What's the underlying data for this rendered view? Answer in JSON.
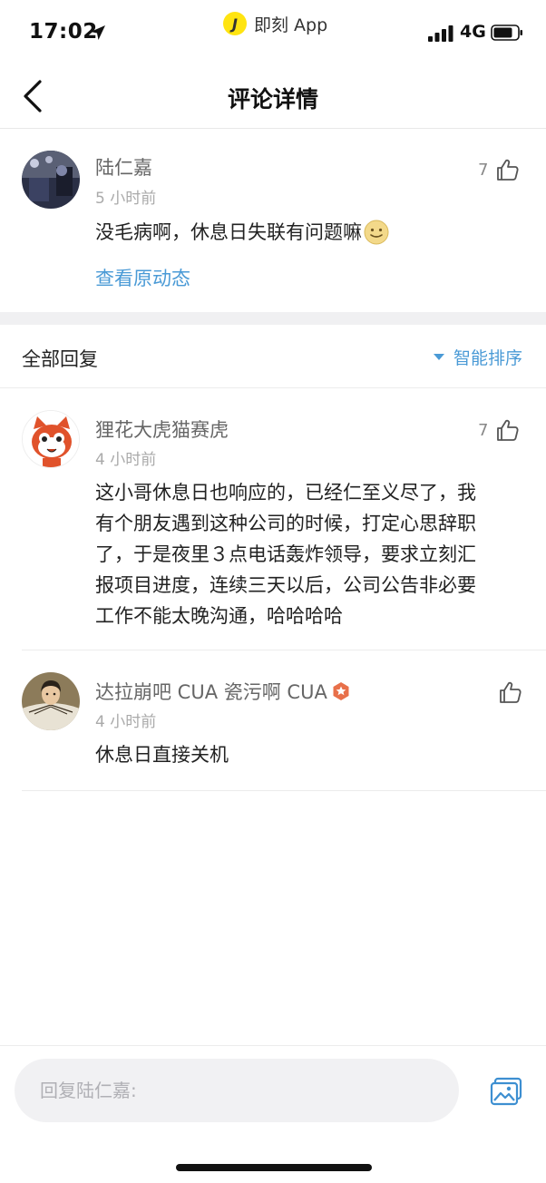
{
  "status_bar": {
    "time": "17:02",
    "app_name": "即刻 App",
    "app_logo_letter": "J",
    "network": "4G"
  },
  "nav": {
    "title": "评论详情"
  },
  "main_comment": {
    "username": "陆仁嘉",
    "time_ago": "5 小时前",
    "text": "没毛病啊，休息日失联有问题嘛",
    "emoji_icon": "smiling-face-emoji",
    "likes": "7",
    "view_original": "查看原动态"
  },
  "replies_header": {
    "title": "全部回复",
    "sort_label": "智能排序"
  },
  "replies": [
    {
      "username": "狸花大虎猫赛虎",
      "time_ago": "4 小时前",
      "likes": "7",
      "lines": [
        "这小哥休息日也响应的，已经仁至义尽了，我",
        "有个朋友遇到这种公司的时候，打定心思辞职",
        "了，于是夜里３点电话轰炸领导，要求立刻汇",
        "报项目进度，连续三天以后，公司公告非必要",
        "工作不能太晚沟通，哈哈哈哈"
      ]
    },
    {
      "username": "达拉崩吧 CUA 瓷污啊 CUA",
      "time_ago": "4 小时前",
      "likes": "",
      "text": "休息日直接关机"
    }
  ],
  "bottom_bar": {
    "reply_placeholder": "回复陆仁嘉:"
  },
  "colors": {
    "link": "#4a9ad6",
    "app_logo": "#ffe411",
    "badge": "#e8704a"
  }
}
